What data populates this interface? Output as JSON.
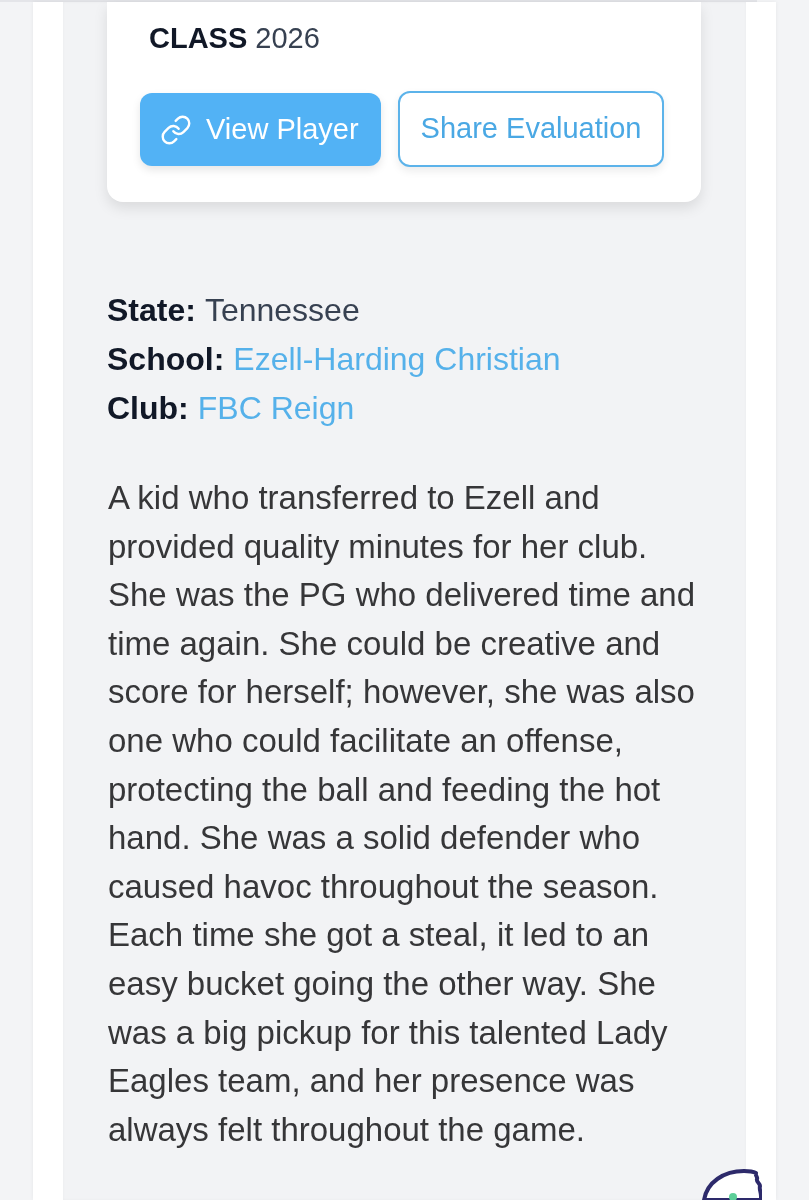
{
  "card": {
    "class": {
      "label": "CLASS",
      "value": "2026"
    },
    "buttons": [
      {
        "label": "View Player",
        "kind": "primary"
      },
      {
        "label": "Share Evaluation",
        "kind": "outline"
      }
    ]
  },
  "details": [
    {
      "label": "State:",
      "value": "Tennessee",
      "kind": "text"
    },
    {
      "label": "School:",
      "value": "Ezell-Harding Christian",
      "kind": "link"
    },
    {
      "label": "Club:",
      "value": "FBC Reign",
      "kind": "link"
    }
  ],
  "evaluation": "A kid who transferred to Ezell and provided quality minutes for her club. She was the PG who delivered time and time again. She could be creative and score for herself; however, she was also one who could facilitate an offense, protecting the ball and feeding the hot hand. She was a solid defender who caused havoc throughout the season. Each time she got a steal, it led to an easy bucket going the other way. She was a big pickup for this talented Lady Eagles team, and her presence was always felt throughout the game."
}
